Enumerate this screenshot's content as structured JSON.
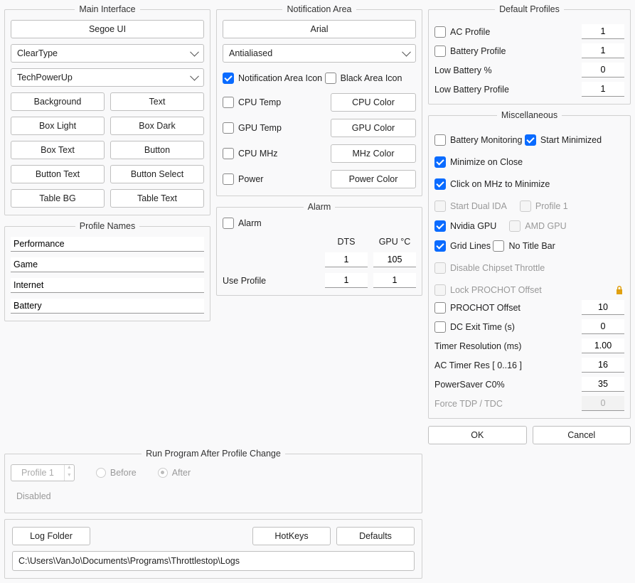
{
  "main_interface": {
    "title": "Main Interface",
    "font_button": "Segoe UI",
    "rendering": "ClearType",
    "skin": "TechPowerUp",
    "buttons": {
      "background": "Background",
      "text": "Text",
      "box_light": "Box Light",
      "box_dark": "Box Dark",
      "box_text": "Box Text",
      "button": "Button",
      "button_text": "Button Text",
      "button_select": "Button Select",
      "table_bg": "Table BG",
      "table_text": "Table Text"
    }
  },
  "profile_names": {
    "title": "Profile Names",
    "items": [
      "Performance",
      "Game",
      "Internet",
      "Battery"
    ]
  },
  "notification": {
    "title": "Notification Area",
    "font_button": "Arial",
    "rendering": "Antialiased",
    "icon_label": "Notification Area Icon",
    "black_icon_label": "Black Area Icon",
    "rows": {
      "cpu_temp": "CPU Temp",
      "cpu_color": "CPU Color",
      "gpu_temp": "GPU Temp",
      "gpu_color": "GPU Color",
      "cpu_mhz": "CPU MHz",
      "mhz_color": "MHz Color",
      "power": "Power",
      "power_color": "Power Color"
    }
  },
  "alarm": {
    "title": "Alarm",
    "alarm_label": "Alarm",
    "dts_header": "DTS",
    "gpu_header": "GPU °C",
    "dts_value": "1",
    "gpu_value": "105",
    "use_profile_label": "Use Profile",
    "use_profile_dts": "1",
    "use_profile_gpu": "1"
  },
  "run_after": {
    "title": "Run Program After Profile Change",
    "spinner": "Profile 1",
    "before": "Before",
    "after": "After",
    "status": "Disabled"
  },
  "bottom": {
    "log_folder": "Log Folder",
    "hotkeys": "HotKeys",
    "defaults": "Defaults",
    "path": "C:\\Users\\VanJo\\Documents\\Programs\\Throttlestop\\Logs"
  },
  "default_profiles": {
    "title": "Default Profiles",
    "ac_profile": "AC Profile",
    "ac_value": "1",
    "battery_profile": "Battery Profile",
    "battery_value": "1",
    "low_battery_pct": "Low Battery %",
    "low_battery_pct_value": "0",
    "low_battery_profile": "Low Battery Profile",
    "low_battery_profile_value": "1"
  },
  "misc": {
    "title": "Miscellaneous",
    "battery_monitoring": "Battery Monitoring",
    "start_minimized": "Start Minimized",
    "minimize_on_close": "Minimize on Close",
    "click_mhz": "Click on MHz to Minimize",
    "start_dual_ida": "Start Dual IDA",
    "profile_1": "Profile 1",
    "nvidia_gpu": "Nvidia GPU",
    "amd_gpu": "AMD GPU",
    "grid_lines": "Grid Lines",
    "no_title_bar": "No Title Bar",
    "disable_chipset": "Disable Chipset Throttle",
    "lock_prochot": "Lock PROCHOT Offset",
    "prochot_offset": "PROCHOT Offset",
    "prochot_offset_value": "10",
    "dc_exit": "DC Exit Time (s)",
    "dc_exit_value": "0",
    "timer_res": "Timer Resolution (ms)",
    "timer_res_value": "1.00",
    "ac_timer": "AC Timer Res [ 0..16 ]",
    "ac_timer_value": "16",
    "powersaver": "PowerSaver C0%",
    "powersaver_value": "35",
    "force_tdp": "Force TDP / TDC",
    "force_tdp_value": "0"
  },
  "footer": {
    "ok": "OK",
    "cancel": "Cancel"
  }
}
